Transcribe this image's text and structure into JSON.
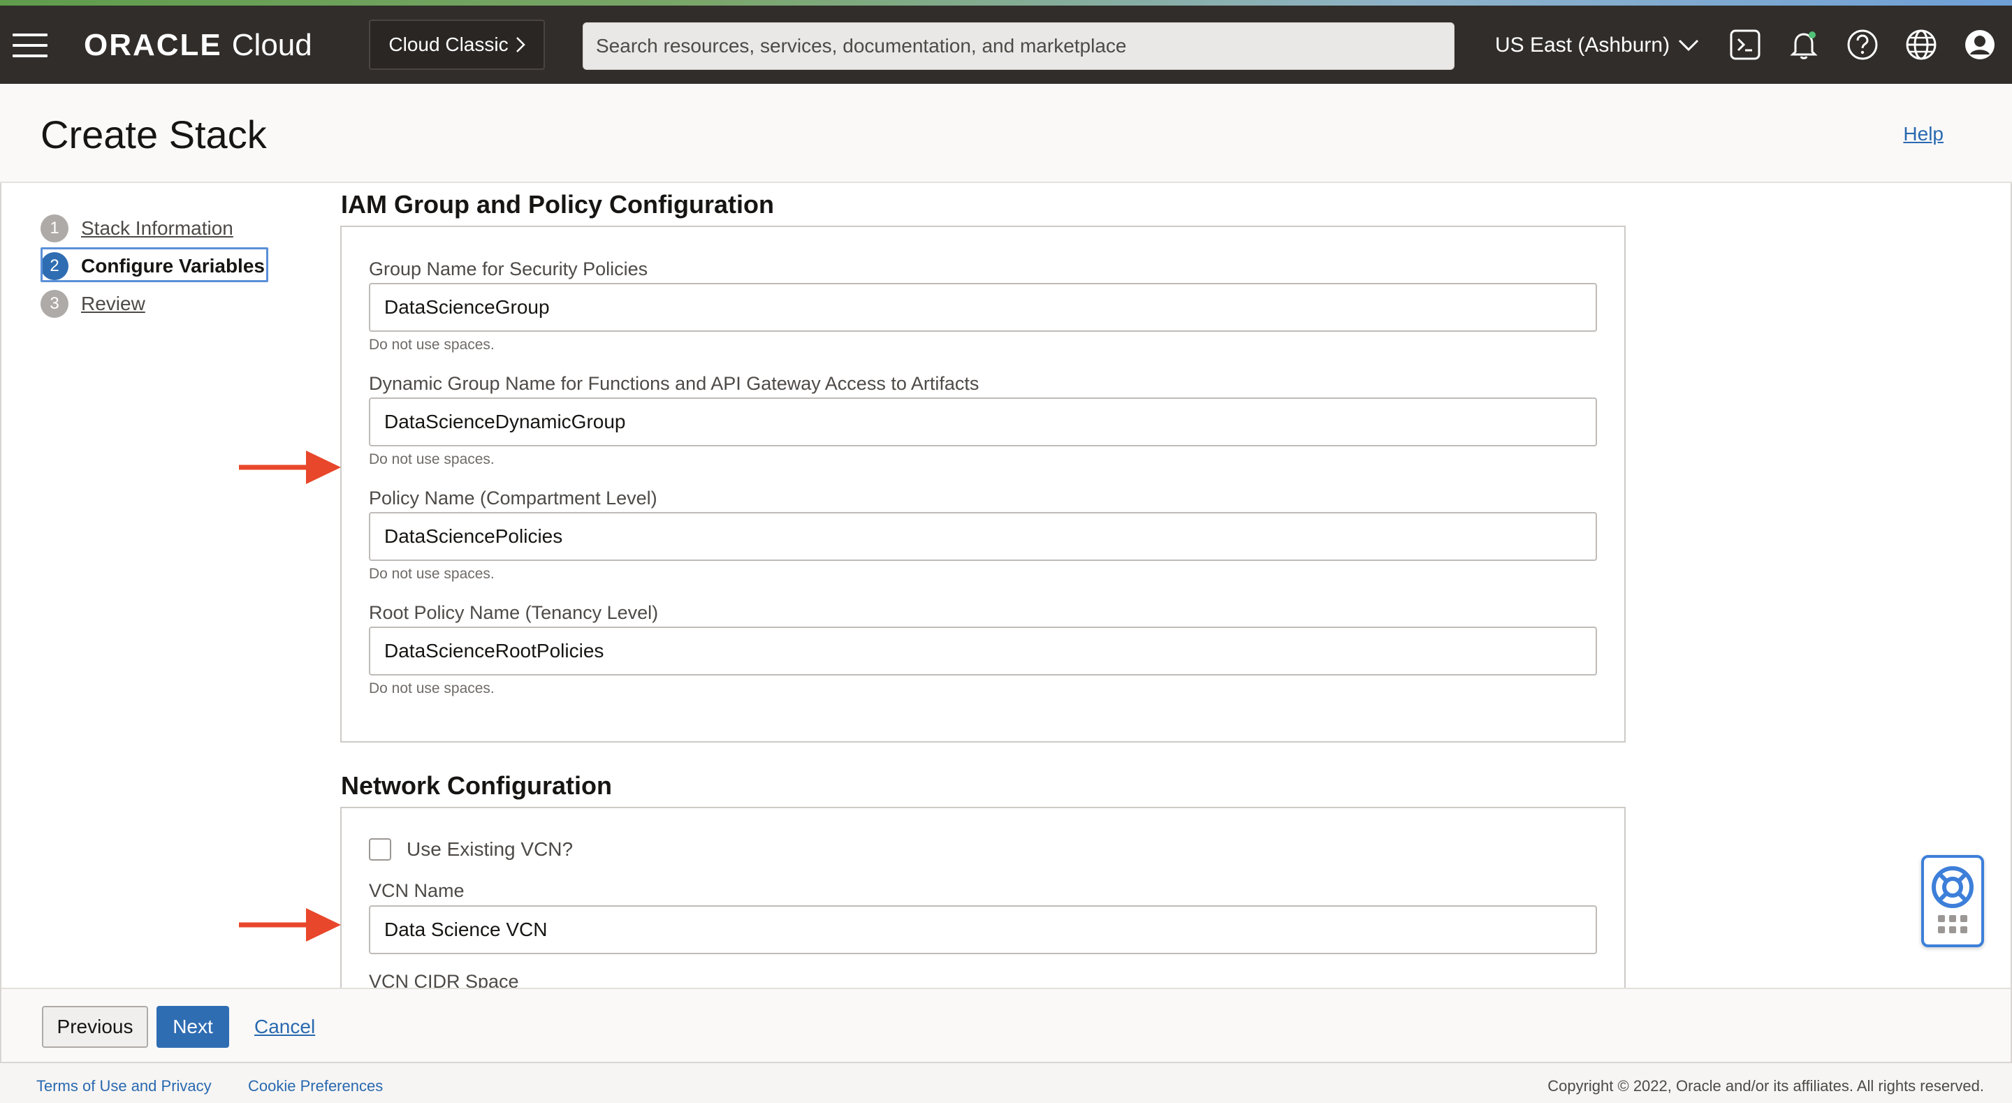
{
  "colors": {
    "header_bg": "#312d2a",
    "accent_blue": "#2f6db3",
    "link": "#2969b0",
    "arrow_red": "#e8472b"
  },
  "header": {
    "brand_oracle": "ORACLE",
    "brand_cloud": "Cloud",
    "cloud_classic": "Cloud Classic",
    "search_placeholder": "Search resources, services, documentation, and marketplace",
    "region": "US East (Ashburn)",
    "icons": [
      "menu-icon",
      "cloud-shell-icon",
      "bell-icon",
      "help-icon",
      "globe-icon",
      "profile-icon"
    ]
  },
  "page": {
    "title": "Create Stack",
    "help": "Help"
  },
  "steps": [
    {
      "num": "1",
      "label": "Stack Information"
    },
    {
      "num": "2",
      "label": "Configure Variables"
    },
    {
      "num": "3",
      "label": "Review"
    }
  ],
  "iam": {
    "title": "IAM Group and Policy Configuration",
    "fields": [
      {
        "label": "Group Name for Security Policies",
        "value": "DataScienceGroup",
        "help": "Do not use spaces."
      },
      {
        "label": "Dynamic Group Name for Functions and API Gateway Access to Artifacts",
        "value": "DataScienceDynamicGroup",
        "help": "Do not use spaces."
      },
      {
        "label": "Policy Name (Compartment Level)",
        "value": "DataSciencePolicies",
        "help": "Do not use spaces."
      },
      {
        "label": "Root Policy Name (Tenancy Level)",
        "value": "DataScienceRootPolicies",
        "help": "Do not use spaces."
      }
    ]
  },
  "network": {
    "title": "Network Configuration",
    "use_existing_vcn": "Use Existing VCN?",
    "vcn_name_label": "VCN Name",
    "vcn_name_value": "Data Science VCN",
    "vcn_cidr_label": "VCN CIDR Space"
  },
  "actions": {
    "previous": "Previous",
    "next": "Next",
    "cancel": "Cancel"
  },
  "footer": {
    "terms": "Terms of Use and Privacy",
    "cookies": "Cookie Preferences",
    "copyright": "Copyright © 2022, Oracle and/or its affiliates. All rights reserved."
  }
}
